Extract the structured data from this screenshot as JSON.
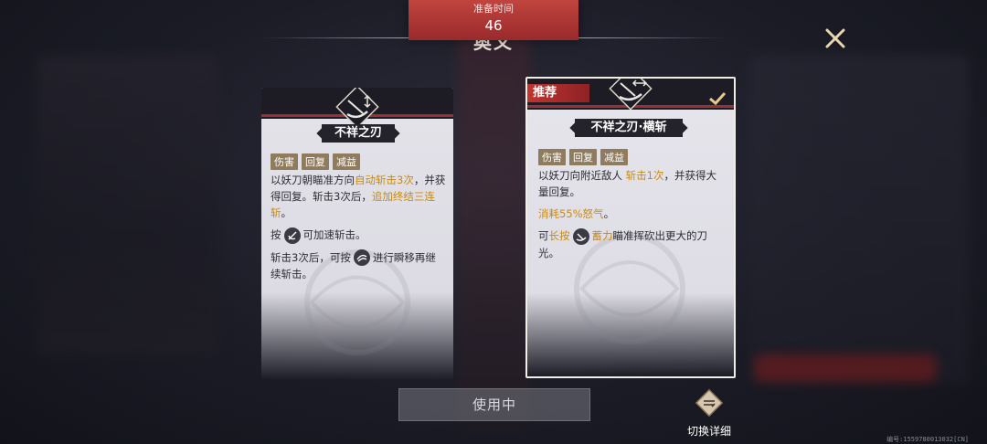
{
  "timer": {
    "label": "准备时间",
    "value": "46"
  },
  "title_behind": "奥义",
  "cards": [
    {
      "name": "不祥之刃",
      "recommended": false,
      "tags": [
        "伤害",
        "回复",
        "减益"
      ],
      "desc1_a": "以妖刀朝瞄准方向",
      "desc1_hl1": "自动斩击3次",
      "desc1_b": "，并获得回复。斩击3次后，",
      "desc1_hl2": "追加终结三连斩",
      "desc1_c": "。",
      "desc2_a": "按",
      "desc2_b": "可加速斩击。",
      "desc3_a": "斩击3次后，可按",
      "desc3_b": "进行瞬移再继续斩击。"
    },
    {
      "name": "不祥之刃·横斩",
      "recommended": true,
      "recommend_label": "推荐",
      "selected": true,
      "tags": [
        "伤害",
        "回复",
        "减益"
      ],
      "desc1_a": "以妖刀向附近敌人 ",
      "desc1_hl1": "斩击1次",
      "desc1_b": "，并获得大量回复。",
      "desc2_hl": "消耗55%怒气",
      "desc2_b": "。",
      "desc3_a": "可",
      "desc3_hl1": "长按",
      "desc3_hl2": "蓄力",
      "desc3_b": "瞄准挥砍出更大的刀光。"
    }
  ],
  "buttons": {
    "use": "使用中",
    "switch_detail": "切换详细"
  },
  "build_id": "编号:1559780013032[CN]",
  "colors": {
    "accent_red": "#9b3034",
    "highlight": "#c78a12",
    "tag": "#8f7b5d"
  }
}
